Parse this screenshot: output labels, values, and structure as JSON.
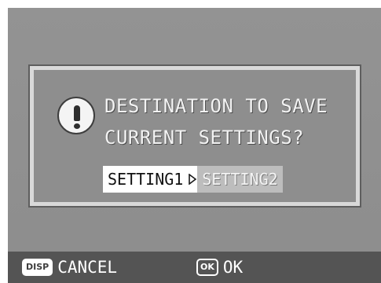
{
  "dialog": {
    "message_line1": "DESTINATION TO SAVE",
    "message_line2": "CURRENT SETTINGS?",
    "options": [
      {
        "label": "SETTING1",
        "selected": true
      },
      {
        "label": "SETTING2",
        "selected": false
      }
    ],
    "icon": "exclamation-icon"
  },
  "footer": {
    "cancel_key": "DISP",
    "cancel_label": "CANCEL",
    "ok_key": "OK",
    "ok_label": "OK"
  }
}
